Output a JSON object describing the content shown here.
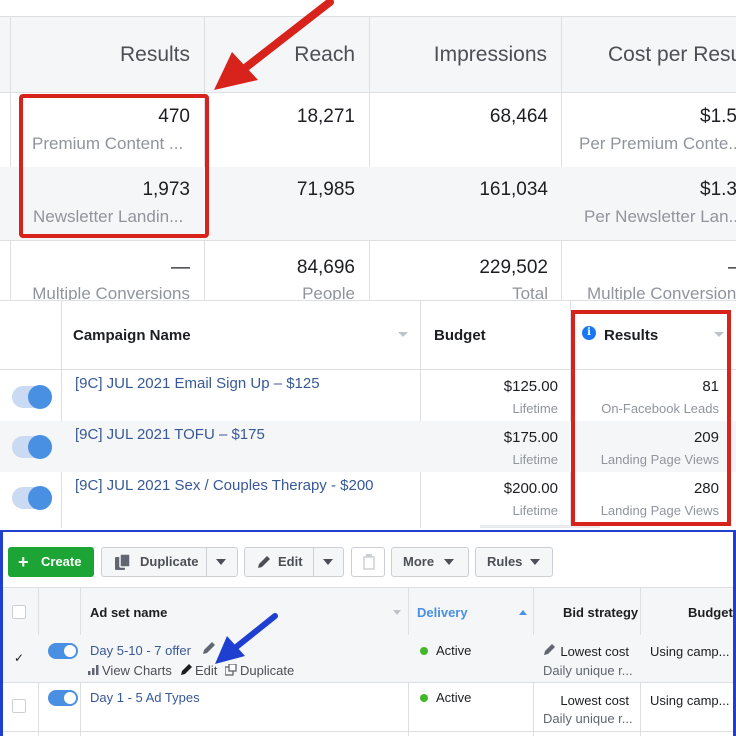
{
  "panel1": {
    "headers": [
      "Results",
      "Reach",
      "Impressions",
      "Cost per Resu"
    ],
    "rows": [
      {
        "results": "470",
        "results_sub": "Premium Content ...",
        "reach": "18,271",
        "impressions": "68,464",
        "cost": "$1.5",
        "cost_sub": "Per Premium Conte..."
      },
      {
        "results": "1,973",
        "results_sub": "Newsletter Landin...",
        "reach": "71,985",
        "impressions": "161,034",
        "cost": "$1.3",
        "cost_sub": "Per Newsletter Lan..."
      },
      {
        "results": "—",
        "results_sub": "Multiple Conversions",
        "reach": "84,696",
        "reach_sub": "People",
        "impressions": "229,502",
        "impressions_sub": "Total",
        "cost": "—",
        "cost_sub": "Multiple Conversion"
      }
    ],
    "highlight_color": "#d8221c"
  },
  "panel2": {
    "headers": {
      "campaign_name": "Campaign Name",
      "budget": "Budget",
      "results": "Results"
    },
    "rows": [
      {
        "name": "[9C] JUL 2021 Email Sign Up – $125",
        "budget": "$125.00",
        "budget_type": "Lifetime",
        "results": "81",
        "result_type": "On-Facebook Leads"
      },
      {
        "name": "[9C] JUL 2021 TOFU – $175",
        "budget": "$175.00",
        "budget_type": "Lifetime",
        "results": "209",
        "result_type": "Landing Page Views"
      },
      {
        "name": "[9C] JUL 2021 Sex / Couples Therapy - $200",
        "budget": "$200.00",
        "budget_type": "Lifetime",
        "results": "280",
        "result_type": "Landing Page Views"
      }
    ],
    "info_icon": "i",
    "link_color": "#385898",
    "toggle_color": "#4a90e2"
  },
  "panel3": {
    "toolbar": {
      "create_label": "Create",
      "create_icon": "+",
      "duplicate_label": "Duplicate",
      "edit_label": "Edit",
      "more_label": "More",
      "rules_label": "Rules"
    },
    "headers": {
      "ad_set_name": "Ad set name",
      "delivery": "Delivery",
      "bid_strategy": "Bid strategy",
      "budget": "Budget"
    },
    "rows": [
      {
        "checked": "✓",
        "name": "Day 5-10 - 7 offer",
        "actions": {
          "view_charts": "View Charts",
          "edit": "Edit",
          "duplicate": "Duplicate"
        },
        "delivery": "Active",
        "bid": "Lowest cost",
        "bid_sub": "Daily unique r...",
        "budget": "Using camp..."
      },
      {
        "checked": "",
        "name": "Day 1 - 5 Ad Types",
        "delivery": "Active",
        "bid": "Lowest cost",
        "bid_sub": "Daily unique r...",
        "budget": "Using camp..."
      }
    ],
    "create_color": "#1ca534",
    "frame_color": "#1e3fcf",
    "active_color": "#42b72a"
  }
}
